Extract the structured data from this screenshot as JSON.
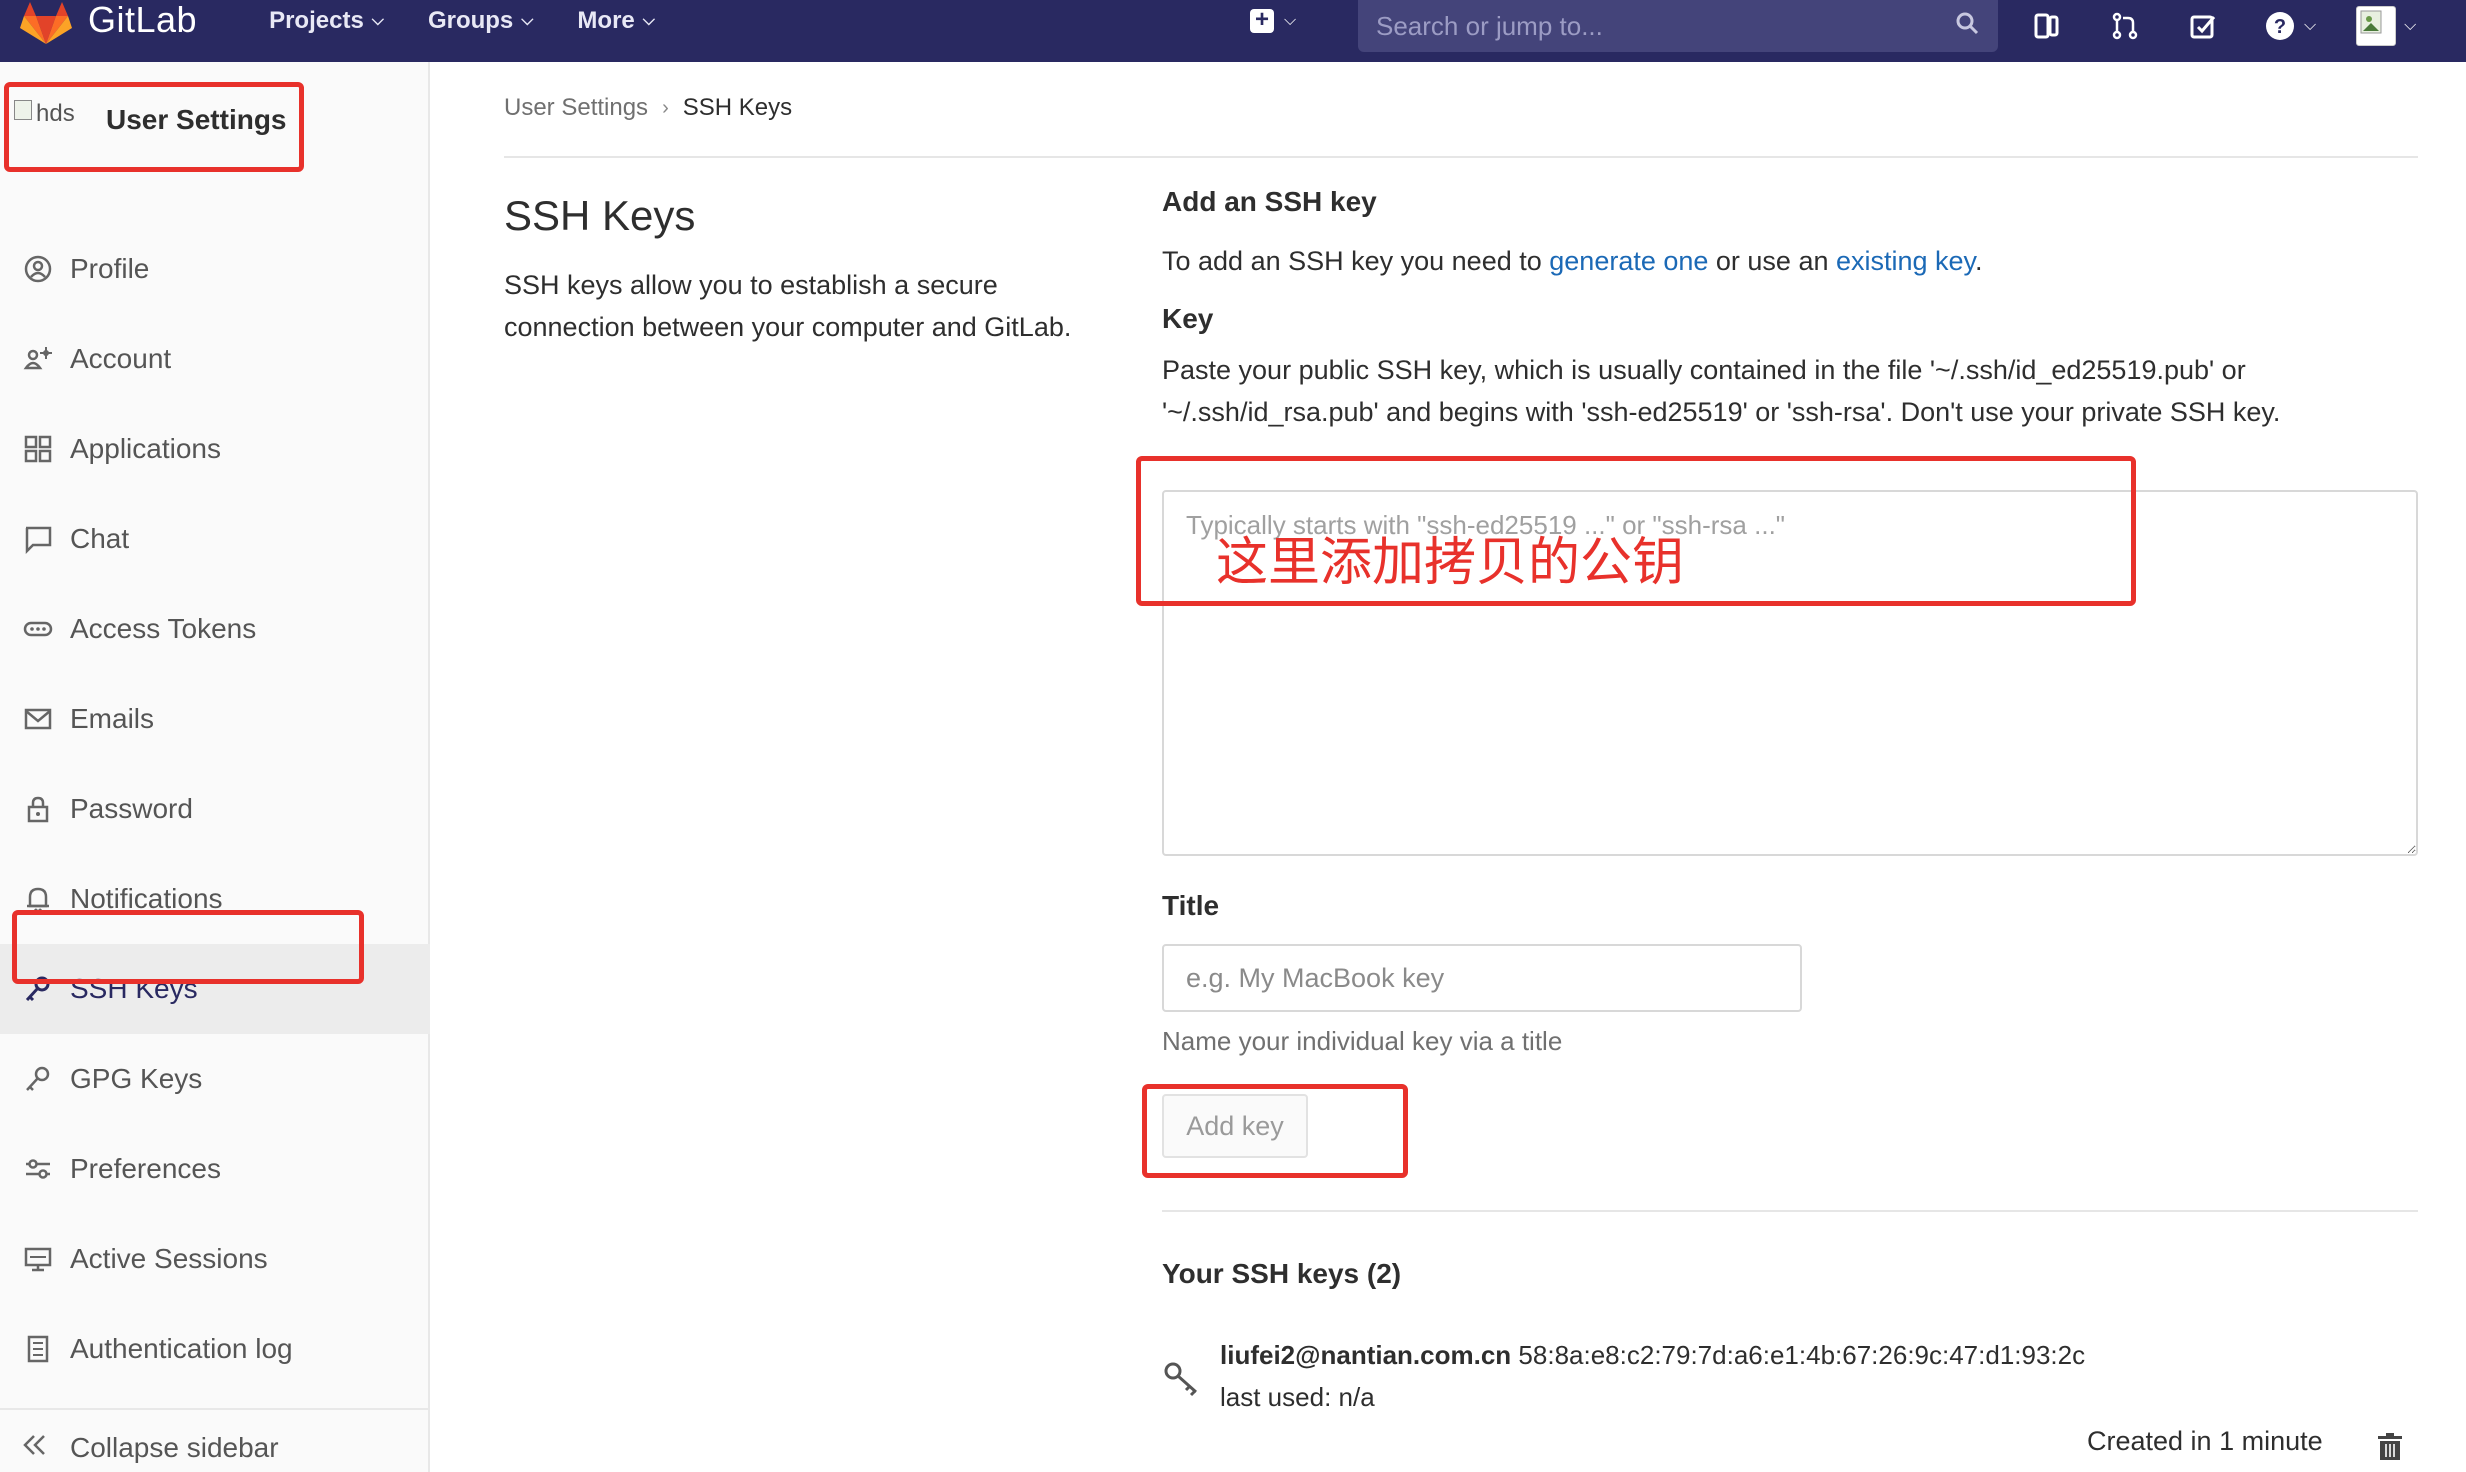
{
  "navbar": {
    "brand": "GitLab",
    "menu": [
      {
        "label": "Projects",
        "icon": "chevron-down-icon"
      },
      {
        "label": "Groups",
        "icon": "chevron-down-icon"
      },
      {
        "label": "More",
        "icon": "chevron-down-icon"
      }
    ],
    "search_placeholder": "Search or jump to...",
    "accent": "#292961"
  },
  "sidebar": {
    "title": "User Settings",
    "avatar_alt": "hds",
    "items": [
      {
        "label": "Profile",
        "icon": "profile-icon"
      },
      {
        "label": "Account",
        "icon": "account-icon"
      },
      {
        "label": "Applications",
        "icon": "applications-icon"
      },
      {
        "label": "Chat",
        "icon": "chat-icon"
      },
      {
        "label": "Access Tokens",
        "icon": "token-icon"
      },
      {
        "label": "Emails",
        "icon": "email-icon"
      },
      {
        "label": "Password",
        "icon": "lock-icon"
      },
      {
        "label": "Notifications",
        "icon": "bell-icon"
      },
      {
        "label": "SSH Keys",
        "icon": "key-icon",
        "active": true
      },
      {
        "label": "GPG Keys",
        "icon": "key-icon"
      },
      {
        "label": "Preferences",
        "icon": "preferences-icon"
      },
      {
        "label": "Active Sessions",
        "icon": "monitor-icon"
      },
      {
        "label": "Authentication log",
        "icon": "log-icon"
      }
    ],
    "collapse_label": "Collapse sidebar"
  },
  "breadcrumb": {
    "parent": "User Settings",
    "current": "SSH Keys"
  },
  "page": {
    "title": "SSH Keys",
    "description": "SSH keys allow you to establish a secure connection between your computer and GitLab."
  },
  "add_key": {
    "heading": "Add an SSH key",
    "intro_before": "To add an SSH key you need to ",
    "link_generate": "generate one",
    "intro_middle": " or use an ",
    "link_existing": "existing key",
    "intro_after": ".",
    "key_label": "Key",
    "key_help": "Paste your public SSH key, which is usually contained in the file '~/.ssh/id_ed25519.pub' or '~/.ssh/id_rsa.pub' and begins with 'ssh-ed25519' or 'ssh-rsa'. Don't use your private SSH key.",
    "key_placeholder": "Typically starts with \"ssh-ed25519 ...\" or \"ssh-rsa ...\"",
    "title_label": "Title",
    "title_placeholder": "e.g. My MacBook key",
    "title_hint": "Name your individual key via a title",
    "submit_label": "Add key"
  },
  "your_keys": {
    "heading": "Your SSH keys (2)",
    "keys": [
      {
        "email": "liufei2@nantian.com.cn",
        "fingerprint": "58:8a:e8:c2:79:7d:a6:e1:4b:67:26:9c:47:d1:93:2c",
        "last_used": "last used: n/a",
        "created": "Created in 1 minute"
      }
    ]
  },
  "annotation": {
    "note": "这里添加拷贝的公钥",
    "color": "#e8312b"
  }
}
